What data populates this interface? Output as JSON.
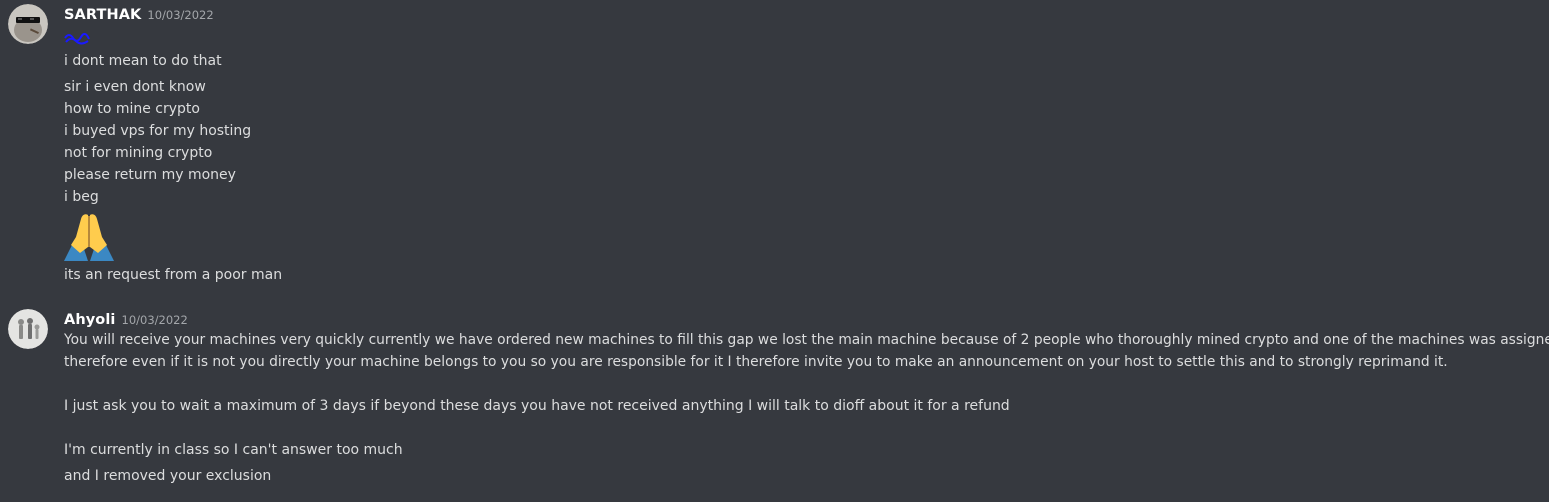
{
  "colors": {
    "background": "#36393f",
    "username": "#ffffff",
    "timestamp": "#a3a6aa",
    "message_text": "#dcddde"
  },
  "messages": [
    {
      "username": "SARTHAK",
      "timestamp": "10/03/2022",
      "avatar_icon": "sunglasses-avatar-icon",
      "lines": [
        "i dont mean to do that",
        "sir i even dont know",
        "how to mine crypto",
        "i buyed vps for my hosting",
        "not for mining crypto",
        "please return my money",
        "i beg"
      ],
      "emoji": "folded-hands-emoji",
      "after_emoji": "its an request from a poor man"
    },
    {
      "username": "Ahyoli",
      "timestamp": "10/03/2022",
      "avatar_icon": "figures-avatar-icon",
      "lines": [
        "You will receive your machines very quickly currently we have ordered new machines to fill this gap we lost the main machine because of 2 people who thoroughly mined crypto and one of the machines was assigned to you",
        "therefore even if it is not you directly your machine belongs to you so you are responsible for it I therefore invite you to make an announcement on your host to settle this and to strongly reprimand it.",
        "I just ask you to wait a maximum of 3 days if beyond these days you have not received anything I will talk to dioff about it for a refund",
        "I'm currently in class so I can't answer too much",
        "and I removed your exclusion"
      ]
    }
  ]
}
